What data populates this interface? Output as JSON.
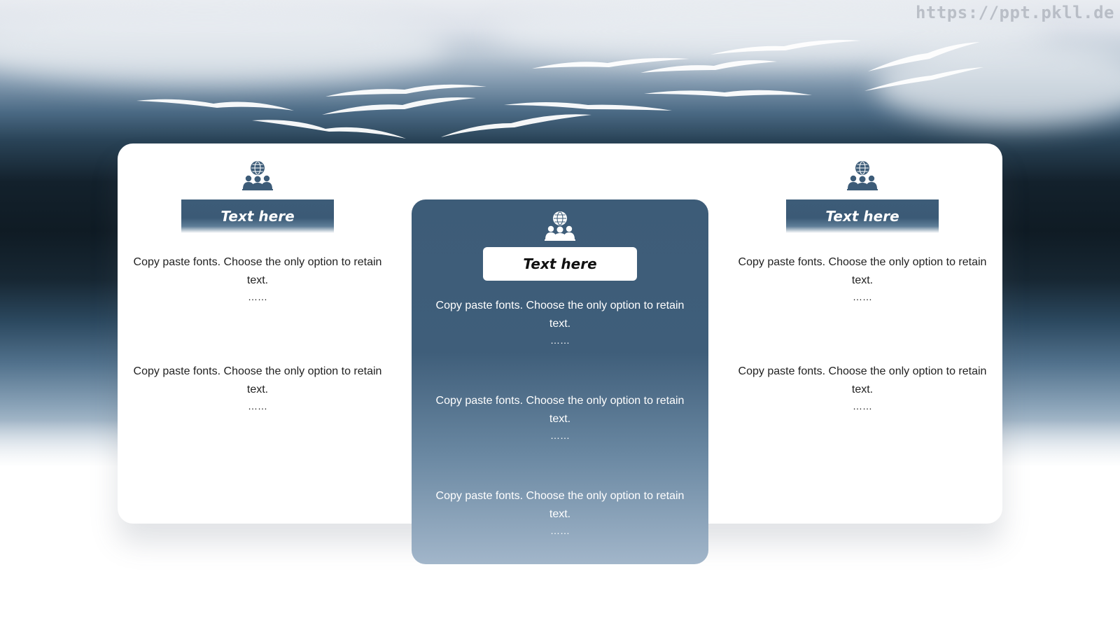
{
  "watermark": "https://ppt.pkll.de",
  "colors": {
    "accent": "#3d5c78",
    "panel_bottom": "#a2b6ca",
    "text": "#222222"
  },
  "icon": "people-globe-icon",
  "left": {
    "title": "Text here",
    "paragraphs": [
      {
        "text": "Copy paste fonts. Choose the only option to retain text.",
        "dots": "……"
      },
      {
        "text": "Copy paste fonts. Choose the only option to retain text.",
        "dots": "……"
      }
    ]
  },
  "center": {
    "title": "Text here",
    "paragraphs": [
      {
        "text": "Copy paste fonts. Choose the only option to retain text.",
        "dots": "……"
      },
      {
        "text": "Copy paste fonts. Choose the only option to retain text.",
        "dots": "……"
      },
      {
        "text": "Copy paste fonts. Choose the only option to retain text.",
        "dots": "……"
      }
    ]
  },
  "right": {
    "title": "Text here",
    "paragraphs": [
      {
        "text": "Copy paste fonts. Choose the only option to retain text.",
        "dots": "……"
      },
      {
        "text": "Copy paste fonts. Choose the only option to retain text.",
        "dots": "……"
      }
    ]
  }
}
